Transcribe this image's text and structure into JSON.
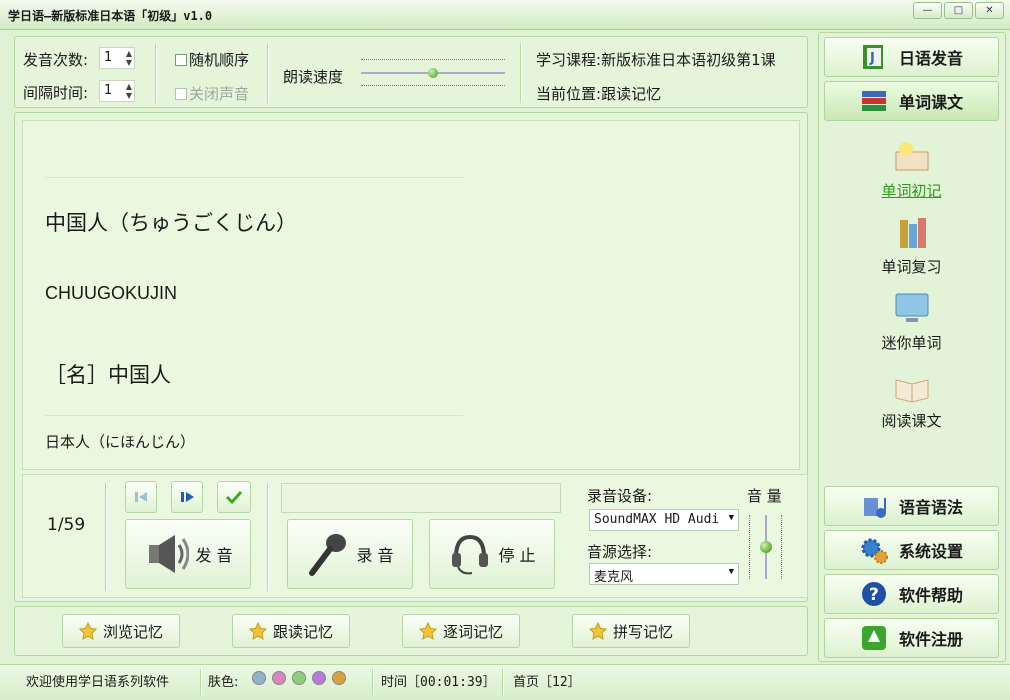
{
  "window": {
    "title": "学日语—新版标准日本语「初级」v1.0",
    "min": "—",
    "max": "□",
    "close": "✕"
  },
  "settings": {
    "play_count_label": "发音次数:",
    "play_count": "1",
    "interval_label": "间隔时间:",
    "interval": "1",
    "random_label": "随机顺序",
    "mute_label": "关闭声音",
    "speed_label": "朗读速度",
    "speed_level": 0.5,
    "course_label": "学习课程:",
    "course": "新版标准日本语初级第1课",
    "position_label": "当前位置:",
    "position": "跟读记忆"
  },
  "word": {
    "kanji_reading": "中国人（ちゅうごくじん）",
    "romaji": "CHUUGOKUJIN",
    "meaning": "［名］中国人",
    "next_word": "日本人（にほんじん）"
  },
  "controls": {
    "counter": "1/59",
    "pronounce": "发 音",
    "record": "录 音",
    "stop": "停 止",
    "rec_device_label": "录音设备:",
    "rec_device": "SoundMAX HD Audi",
    "source_label": "音源选择:",
    "source": "麦克风",
    "volume_label": "音 量",
    "volume_level": 0.5
  },
  "modes": [
    "浏览记忆",
    "跟读记忆",
    "逐词记忆",
    "拼写记忆"
  ],
  "nav": {
    "pronunciation": "日语发音",
    "vocab": "单词课文",
    "sub": [
      "单词初记",
      "单词复习",
      "迷你单词",
      "阅读课文"
    ],
    "grammar": "语音语法",
    "settings": "系统设置",
    "help": "软件帮助",
    "register": "软件注册"
  },
  "status": {
    "welcome": "欢迎使用学日语系列软件",
    "skin_label": "肤色:",
    "skins": [
      "#8fb3cc",
      "#d985c0",
      "#8ad07a",
      "#b77ad9",
      "#d9a23a"
    ],
    "time": "时间［00:01:39］",
    "page": "首页［12］"
  },
  "colors": {
    "accent_green": "#4caa2c",
    "link_green": "#2d9c1c",
    "bg": "#dff2d4"
  }
}
